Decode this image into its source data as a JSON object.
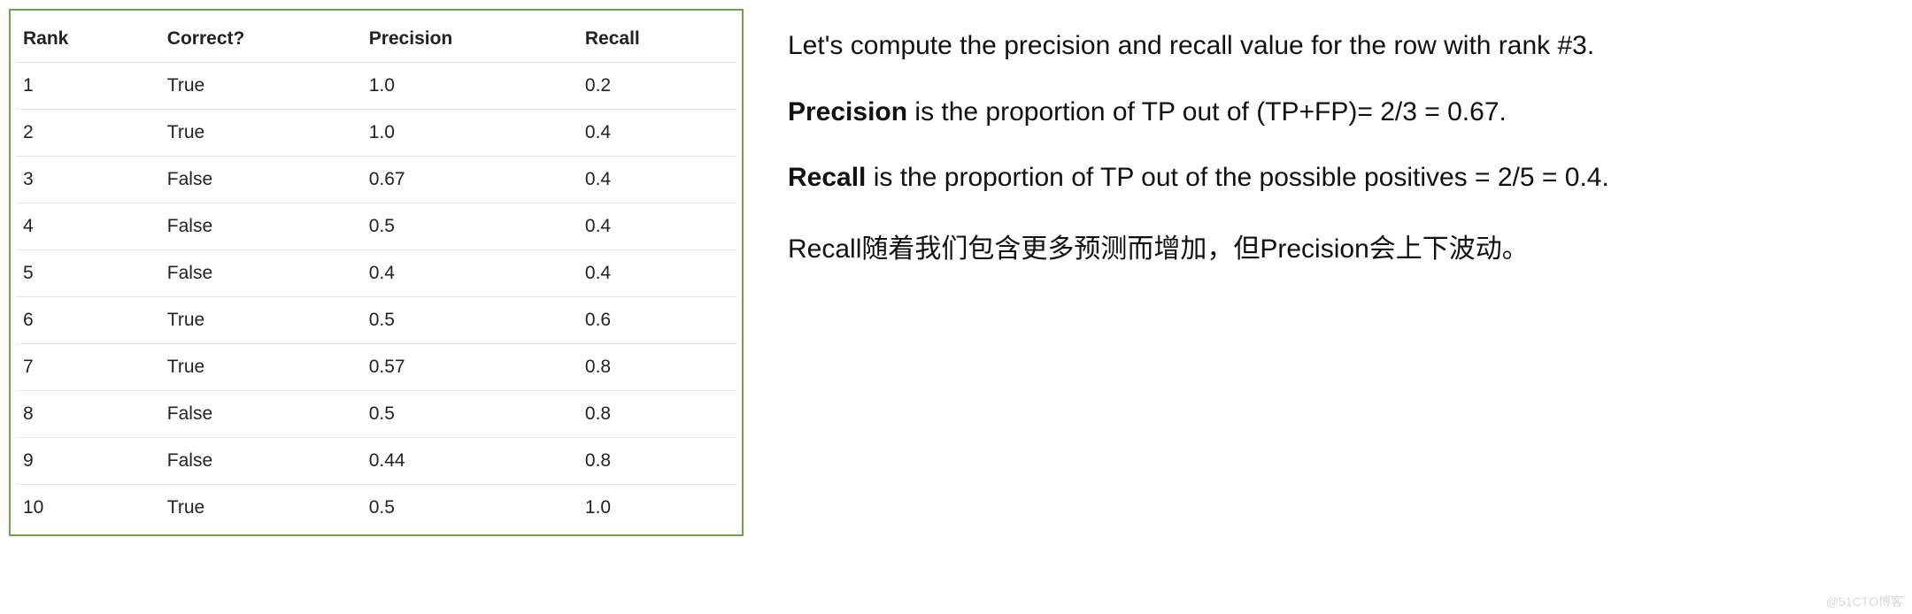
{
  "table": {
    "headers": {
      "rank": "Rank",
      "correct": "Correct?",
      "precision": "Precision",
      "recall": "Recall"
    },
    "rows": [
      {
        "rank": "1",
        "correct": "True",
        "precision": "1.0",
        "recall": "0.2"
      },
      {
        "rank": "2",
        "correct": "True",
        "precision": "1.0",
        "recall": "0.4"
      },
      {
        "rank": "3",
        "correct": "False",
        "precision": "0.67",
        "recall": "0.4"
      },
      {
        "rank": "4",
        "correct": "False",
        "precision": "0.5",
        "recall": "0.4"
      },
      {
        "rank": "5",
        "correct": "False",
        "precision": "0.4",
        "recall": "0.4"
      },
      {
        "rank": "6",
        "correct": "True",
        "precision": "0.5",
        "recall": "0.6"
      },
      {
        "rank": "7",
        "correct": "True",
        "precision": "0.57",
        "recall": "0.8"
      },
      {
        "rank": "8",
        "correct": "False",
        "precision": "0.5",
        "recall": "0.8"
      },
      {
        "rank": "9",
        "correct": "False",
        "precision": "0.44",
        "recall": "0.8"
      },
      {
        "rank": "10",
        "correct": "True",
        "precision": "0.5",
        "recall": "1.0"
      }
    ]
  },
  "text": {
    "intro": "Let's compute the precision and recall value for the row with rank #3.",
    "precision_label": "Precision",
    "precision_body": " is the proportion of TP out of (TP+FP)= 2/3 = 0.67.",
    "recall_label": "Recall",
    "recall_body": " is the proportion of TP out of the possible positives = 2/5 = 0.4.",
    "cjk": "Recall随着我们包含更多预测而增加，但Precision会上下波动。"
  },
  "watermark": "@51CTO博客"
}
